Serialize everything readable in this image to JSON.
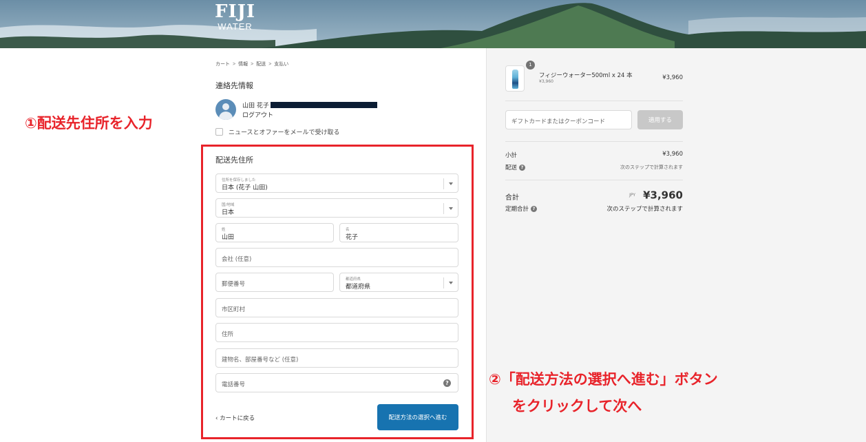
{
  "brand": {
    "logo_main": "FIJI",
    "logo_sub": "WATER",
    "accent_red": "#e8232a",
    "button_blue": "#1773b0"
  },
  "breadcrumb": {
    "items": [
      "カート",
      "情報",
      "配送",
      "支払い"
    ],
    "separator": ">"
  },
  "contact": {
    "title": "連絡先情報",
    "user_name": "山田 花子",
    "logout": "ログアウト",
    "newsletter": "ニュースとオファーをメールで受け取る"
  },
  "shipping": {
    "title": "配送先住所",
    "saved_address": {
      "label": "住所を保存しました",
      "value": "日本 (花子 山田)"
    },
    "country": {
      "label": "国/地域",
      "value": "日本"
    },
    "last_name": {
      "label": "姓",
      "value": "山田"
    },
    "first_name": {
      "label": "名",
      "value": "花子"
    },
    "company": {
      "placeholder": "会社 (任意)"
    },
    "postal_code": {
      "placeholder": "郵便番号"
    },
    "prefecture": {
      "label": "都道府県",
      "value": "都道府県"
    },
    "city": {
      "placeholder": "市区町村"
    },
    "address": {
      "placeholder": "住所"
    },
    "building": {
      "placeholder": "建物名、部屋番号など (任意)"
    },
    "phone": {
      "placeholder": "電話番号"
    },
    "back_link": "‹ カートに戻る",
    "continue_button": "配送方法の選択へ進む"
  },
  "annotations": {
    "step1": "①配送先住所を入力",
    "step2_line1": "②「配送方法の選択へ進む」ボタン",
    "step2_line2": "をクリックして次へ"
  },
  "order_summary": {
    "product": {
      "quantity": "1",
      "name": "フィジーウォーター500ml x 24 本",
      "unit_price": "¥3,960",
      "price": "¥3,960"
    },
    "coupon_placeholder": "ギフトカードまたはクーポンコード",
    "apply_button": "適用する",
    "subtotal_label": "小計",
    "subtotal_value": "¥3,960",
    "shipping_label": "配送",
    "shipping_value": "次のステップで計算されます",
    "total_label": "合計",
    "total_currency": "JPY",
    "total_value": "¥3,960",
    "recurring_label": "定期合計",
    "recurring_value": "次のステップで計算されます"
  }
}
